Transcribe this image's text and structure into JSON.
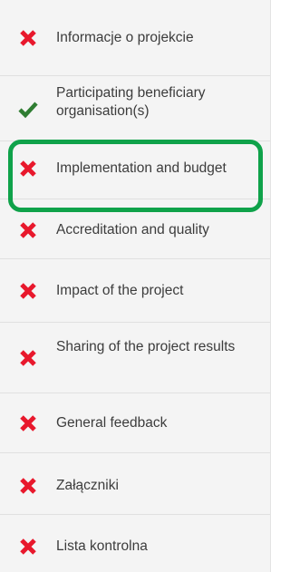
{
  "sidebar": {
    "items": [
      {
        "label": "Informacje o projekcie",
        "status": "incomplete",
        "icon": "cross-icon"
      },
      {
        "label": "Participating beneficiary organisation(s)",
        "status": "complete",
        "icon": "checkmark-icon"
      },
      {
        "label": "Implementation and budget",
        "status": "incomplete",
        "icon": "cross-icon",
        "highlighted": true
      },
      {
        "label": "Accreditation and quality",
        "status": "incomplete",
        "icon": "cross-icon"
      },
      {
        "label": "Impact of the project",
        "status": "incomplete",
        "icon": "cross-icon"
      },
      {
        "label": "Sharing of the project results",
        "status": "incomplete",
        "icon": "cross-icon"
      },
      {
        "label": "General feedback",
        "status": "incomplete",
        "icon": "cross-icon"
      },
      {
        "label": "Załączniki",
        "status": "incomplete",
        "icon": "cross-icon"
      },
      {
        "label": "Lista kontrolna",
        "status": "incomplete",
        "icon": "cross-icon"
      }
    ]
  },
  "colors": {
    "incomplete": "#e8182c",
    "complete": "#2f7d32",
    "highlight": "#0fa24a",
    "background": "#f4f4f4",
    "text": "#3c3c3c"
  }
}
